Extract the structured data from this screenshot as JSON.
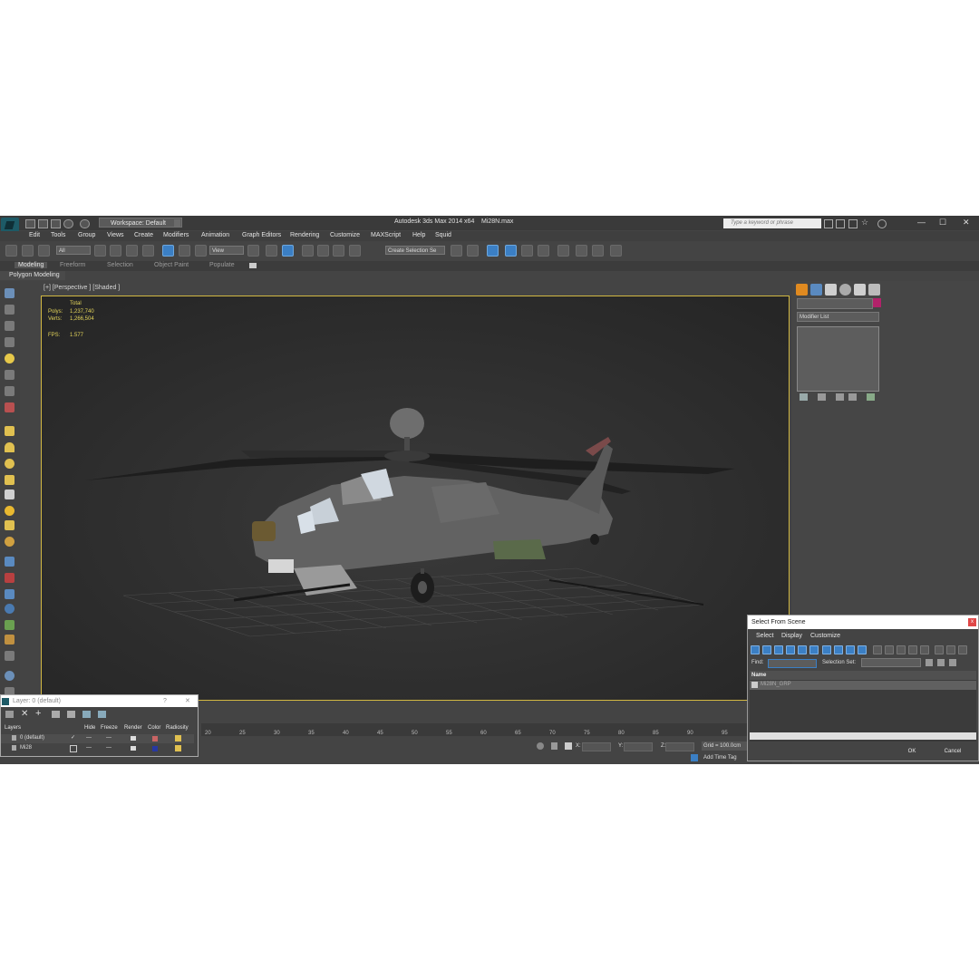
{
  "window": {
    "app_title": "Autodesk 3ds Max  2014 x64",
    "file_name": "Mi28N.max",
    "workspace": "Workspace: Default",
    "search_placeholder": "Type a keyword or phrase"
  },
  "menu": [
    "Edit",
    "Tools",
    "Group",
    "Views",
    "Create",
    "Modifiers",
    "Animation",
    "Graph Editors",
    "Rendering",
    "Customize",
    "MAXScript",
    "Help",
    "Squid"
  ],
  "toolbar": {
    "filter_value": "All",
    "ref_coord_value": "View",
    "selection_set_placeholder": "Create Selection Se"
  },
  "ribbon": {
    "tabs": [
      "Modeling",
      "Freeform",
      "Selection",
      "Object Paint",
      "Populate"
    ],
    "active_tab": "Modeling",
    "panel": "Polygon Modeling"
  },
  "viewport": {
    "label": "[+] [Perspective ] [Shaded ]",
    "stats": {
      "total_label": "Total",
      "polys_label": "Polys:",
      "polys_value": "1,237,740",
      "verts_label": "Verts:",
      "verts_value": "1,266,504",
      "fps_label": "FPS:",
      "fps_value": "1.577"
    }
  },
  "command_panel": {
    "modifier_list": "Modifier List",
    "object_color": "#b2226a"
  },
  "timeline": {
    "ticks": [
      "20",
      "25",
      "30",
      "35",
      "40",
      "45",
      "50",
      "55",
      "60",
      "65",
      "70",
      "75",
      "80",
      "85",
      "90",
      "95"
    ]
  },
  "status": {
    "x_label": "X:",
    "y_label": "Y:",
    "z_label": "Z:",
    "grid": "Grid = 100.0cm",
    "add_time_tag": "Add Time Tag"
  },
  "layer_dialog": {
    "title": "Layer: 0 (default)",
    "help": "?",
    "close": "✕",
    "columns": [
      "Layers",
      "Hide",
      "Freeze",
      "Render",
      "Color",
      "Radiosity"
    ],
    "rows": [
      {
        "name": "0 (default)",
        "hide": "—",
        "freeze": "—",
        "color": "#c86464"
      },
      {
        "name": "Mi28",
        "hide": "—",
        "freeze": "—",
        "color": "#2838a0"
      }
    ]
  },
  "select_from_scene": {
    "title": "Select From Scene",
    "close": "x",
    "menu": [
      "Select",
      "Display",
      "Customize"
    ],
    "find_label": "Find:",
    "selection_set_label": "Selection Set:",
    "column_name": "Name",
    "items": [
      "Mi28N_GRP"
    ],
    "ok": "OK",
    "cancel": "Cancel"
  }
}
